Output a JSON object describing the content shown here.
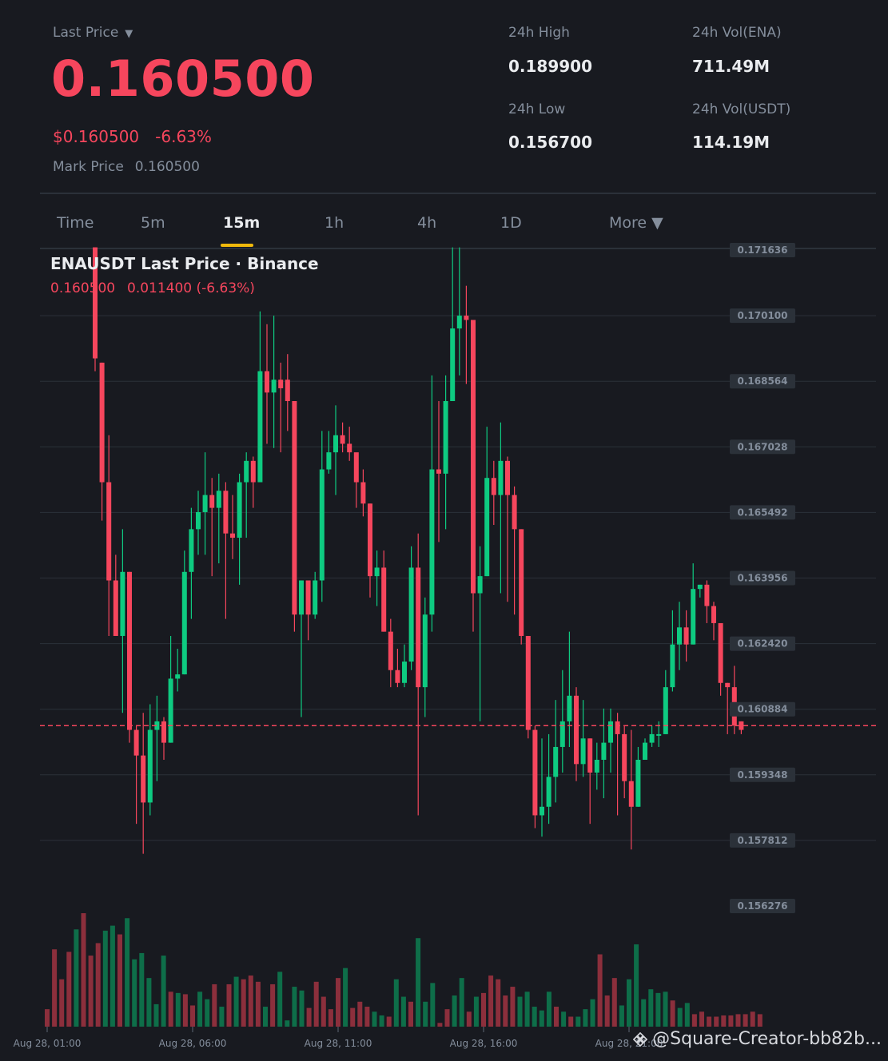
{
  "header": {
    "last_price_label": "Last Price",
    "caret": "▼",
    "last_price": "0.160500",
    "usd_price": "$0.160500",
    "change_pct": "-6.63%",
    "mark_label": "Mark Price",
    "mark_value": "0.160500"
  },
  "stats": {
    "high_label": "24h High",
    "high_value": "0.189900",
    "low_label": "24h Low",
    "low_value": "0.156700",
    "vol_base_label": "24h Vol(ENA)",
    "vol_base_value": "711.49M",
    "vol_quote_label": "24h Vol(USDT)",
    "vol_quote_value": "114.19M"
  },
  "tabs": [
    {
      "label": "Time",
      "active": false
    },
    {
      "label": "5m",
      "active": false
    },
    {
      "label": "15m",
      "active": true
    },
    {
      "label": "1h",
      "active": false
    },
    {
      "label": "4h",
      "active": false
    },
    {
      "label": "1D",
      "active": false
    },
    {
      "label": "More ▼",
      "active": false
    }
  ],
  "chart": {
    "title": "ENAUSDT Last Price · Binance",
    "legend_price": "0.160500",
    "legend_change": "0.011400 (-6.63%)"
  },
  "watermark": "@Square-Creator-bb82b...",
  "colors": {
    "up": "#0ecb81",
    "down": "#f6465d",
    "bg": "#181a20",
    "accent": "#f0b90b"
  },
  "chart_data": {
    "type": "candlestick",
    "ylim": [
      0.156276,
      0.171636
    ],
    "y_ticks": [
      "0.171636",
      "0.170100",
      "0.168564",
      "0.167028",
      "0.165492",
      "0.163956",
      "0.162420",
      "0.160884",
      "0.159348",
      "0.157812",
      "0.156276"
    ],
    "x_ticks": [
      "Aug 28, 01:00",
      "Aug 28, 06:00",
      "Aug 28, 11:00",
      "Aug 28, 16:00",
      "Aug 28, 21:00"
    ],
    "current_price": 0.1605,
    "candles": [
      [
        0.1717,
        0.1691,
        0.1717,
        0.1688
      ],
      [
        0.169,
        0.1662,
        0.169,
        0.1653
      ],
      [
        0.1662,
        0.1639,
        0.1673,
        0.1626
      ],
      [
        0.1639,
        0.1626,
        0.1645,
        0.1626
      ],
      [
        0.1626,
        0.1641,
        0.1651,
        0.1608
      ],
      [
        0.1641,
        0.1604,
        0.1641,
        0.1601
      ],
      [
        0.1604,
        0.1598,
        0.1605,
        0.1582
      ],
      [
        0.1598,
        0.1587,
        0.1608,
        0.1575
      ],
      [
        0.1587,
        0.1604,
        0.161,
        0.1584
      ],
      [
        0.1604,
        0.1606,
        0.1612,
        0.1592
      ],
      [
        0.1606,
        0.1601,
        0.1607,
        0.1597
      ],
      [
        0.1601,
        0.1616,
        0.1626,
        0.1601
      ],
      [
        0.1616,
        0.1617,
        0.1623,
        0.1613
      ],
      [
        0.1617,
        0.1641,
        0.1646,
        0.1617
      ],
      [
        0.1641,
        0.1651,
        0.1656,
        0.163
      ],
      [
        0.1651,
        0.1655,
        0.166,
        0.1645
      ],
      [
        0.1655,
        0.1659,
        0.1669,
        0.1645
      ],
      [
        0.1659,
        0.1656,
        0.1663,
        0.164
      ],
      [
        0.1656,
        0.166,
        0.1664,
        0.1643
      ],
      [
        0.166,
        0.165,
        0.1662,
        0.163
      ],
      [
        0.165,
        0.1649,
        0.1659,
        0.1644
      ],
      [
        0.1649,
        0.1662,
        0.1664,
        0.1638
      ],
      [
        0.1662,
        0.1667,
        0.1669,
        0.1649
      ],
      [
        0.1667,
        0.1662,
        0.1668,
        0.1656
      ],
      [
        0.1662,
        0.1688,
        0.1702,
        0.1662
      ],
      [
        0.1688,
        0.1683,
        0.1699,
        0.1671
      ],
      [
        0.1683,
        0.1686,
        0.1701,
        0.167
      ],
      [
        0.1686,
        0.1684,
        0.169,
        0.1669
      ],
      [
        0.1686,
        0.1681,
        0.1692,
        0.1674
      ],
      [
        0.1681,
        0.1631,
        0.1681,
        0.1627
      ],
      [
        0.1631,
        0.1639,
        0.1639,
        0.1607
      ],
      [
        0.1639,
        0.1631,
        0.1639,
        0.1625
      ],
      [
        0.1631,
        0.1639,
        0.1641,
        0.163
      ],
      [
        0.1639,
        0.1665,
        0.1674,
        0.1634
      ],
      [
        0.1665,
        0.1669,
        0.1674,
        0.1664
      ],
      [
        0.1669,
        0.1673,
        0.168,
        0.1659
      ],
      [
        0.1673,
        0.1671,
        0.1676,
        0.1669
      ],
      [
        0.1671,
        0.1669,
        0.1675,
        0.1667
      ],
      [
        0.1669,
        0.1662,
        0.1668,
        0.1656
      ],
      [
        0.1662,
        0.1657,
        0.1665,
        0.1654
      ],
      [
        0.1657,
        0.164,
        0.1657,
        0.1635
      ],
      [
        0.164,
        0.1642,
        0.1646,
        0.1633
      ],
      [
        0.1642,
        0.1627,
        0.1646,
        0.1627
      ],
      [
        0.1627,
        0.1618,
        0.163,
        0.1614
      ],
      [
        0.1618,
        0.1615,
        0.1623,
        0.1614
      ],
      [
        0.1615,
        0.162,
        0.1624,
        0.1614
      ],
      [
        0.162,
        0.1642,
        0.1647,
        0.1618
      ],
      [
        0.1642,
        0.1614,
        0.165,
        0.1584
      ],
      [
        0.1614,
        0.1631,
        0.1635,
        0.1607
      ],
      [
        0.1631,
        0.1665,
        0.1687,
        0.1627
      ],
      [
        0.1665,
        0.1664,
        0.1681,
        0.1648
      ],
      [
        0.1664,
        0.1681,
        0.1687,
        0.1651
      ],
      [
        0.1681,
        0.1698,
        0.1717,
        0.1681
      ],
      [
        0.1698,
        0.1701,
        0.1717,
        0.1687
      ],
      [
        0.1701,
        0.17,
        0.1708,
        0.1685
      ],
      [
        0.17,
        0.1636,
        0.17,
        0.1627
      ],
      [
        0.1636,
        0.164,
        0.1647,
        0.1606
      ],
      [
        0.164,
        0.1663,
        0.1675,
        0.164
      ],
      [
        0.1663,
        0.1659,
        0.1667,
        0.1652
      ],
      [
        0.1659,
        0.1667,
        0.1676,
        0.1636
      ],
      [
        0.1667,
        0.1659,
        0.1668,
        0.1634
      ],
      [
        0.1659,
        0.1651,
        0.1661,
        0.1631
      ],
      [
        0.1651,
        0.1626,
        0.1651,
        0.1624
      ],
      [
        0.1626,
        0.1604,
        0.1626,
        0.1602
      ],
      [
        0.1604,
        0.1584,
        0.1605,
        0.1581
      ],
      [
        0.1584,
        0.1586,
        0.1602,
        0.1579
      ],
      [
        0.1586,
        0.1593,
        0.1603,
        0.1582
      ],
      [
        0.1593,
        0.16,
        0.1611,
        0.1587
      ],
      [
        0.16,
        0.1606,
        0.1618,
        0.1594
      ],
      [
        0.1606,
        0.1612,
        0.1627,
        0.16
      ],
      [
        0.1612,
        0.1596,
        0.1614,
        0.1592
      ],
      [
        0.1596,
        0.1602,
        0.1611,
        0.1593
      ],
      [
        0.1602,
        0.1594,
        0.1602,
        0.1582
      ],
      [
        0.1594,
        0.1597,
        0.1601,
        0.159
      ],
      [
        0.1597,
        0.1601,
        0.1609,
        0.1588
      ],
      [
        0.1601,
        0.1606,
        0.1609,
        0.1594
      ],
      [
        0.1606,
        0.1603,
        0.1608,
        0.1584
      ],
      [
        0.1603,
        0.1592,
        0.1605,
        0.1588
      ],
      [
        0.1592,
        0.1586,
        0.1604,
        0.1576
      ],
      [
        0.1586,
        0.1597,
        0.16,
        0.1586
      ],
      [
        0.1597,
        0.1601,
        0.1602,
        0.1599
      ],
      [
        0.1601,
        0.1603,
        0.1605,
        0.16
      ],
      [
        0.1603,
        0.1603,
        0.1606,
        0.16
      ],
      [
        0.1603,
        0.1614,
        0.1618,
        0.1603
      ],
      [
        0.1614,
        0.1624,
        0.1632,
        0.1613
      ],
      [
        0.1624,
        0.1628,
        0.1634,
        0.1618
      ],
      [
        0.1628,
        0.1624,
        0.1632,
        0.162
      ],
      [
        0.1624,
        0.1637,
        0.1643,
        0.1624
      ],
      [
        0.1637,
        0.1638,
        0.1638,
        0.1635
      ],
      [
        0.1638,
        0.1633,
        0.1639,
        0.1629
      ],
      [
        0.1633,
        0.1629,
        0.1634,
        0.1625
      ],
      [
        0.1629,
        0.1615,
        0.1628,
        0.1612
      ],
      [
        0.1615,
        0.1614,
        0.1615,
        0.1603
      ],
      [
        0.1614,
        0.1605,
        0.1619,
        0.1603
      ],
      [
        0.1606,
        0.1604,
        0.1606,
        0.1603
      ]
    ],
    "volumes": [
      14,
      62,
      38,
      60,
      78,
      91,
      57,
      67,
      77,
      81,
      74,
      87,
      54,
      59,
      39,
      18,
      57,
      28,
      27,
      26,
      17,
      28,
      22,
      34,
      16,
      34,
      40,
      38,
      41,
      36,
      16,
      34,
      44,
      5,
      32,
      29,
      15,
      36,
      24,
      14,
      39,
      47,
      15,
      20,
      16,
      12,
      9,
      8,
      38,
      24,
      20,
      71,
      20,
      35,
      3,
      14,
      25,
      39,
      12,
      24,
      27,
      41,
      38,
      25,
      32,
      24,
      28,
      16,
      13,
      28,
      16,
      12,
      8,
      8,
      14,
      22,
      58,
      25,
      39,
      17,
      38,
      66,
      22,
      30,
      27,
      28,
      21,
      15,
      19,
      10,
      12,
      8,
      8,
      9,
      9,
      10,
      10,
      12,
      10
    ]
  }
}
